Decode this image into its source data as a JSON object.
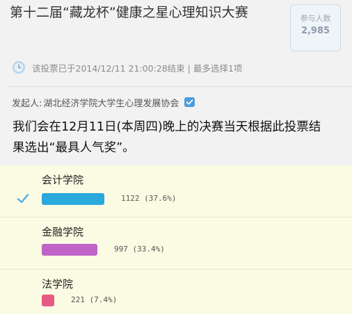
{
  "poll": {
    "title": "第十二届“藏龙杯”健康之星心理知识大赛",
    "participants_label": "参与人数",
    "participants_count": "2,985",
    "status_text": "该投票已于2014/12/11 21:00:28结束 | 最多选择1项",
    "initiator_prefix": "发起人:",
    "initiator_name": "湖北经济学院大学生心理发展协会",
    "description": "我们会在12月11日(本周四)晚上的决赛当天根据此投票结果选出“最具人气奖”。",
    "options": [
      {
        "label": "会计学院",
        "votes": "1122",
        "percent": "(37.6%)",
        "share": 0.376,
        "color": "#29a9dc",
        "selected": true
      },
      {
        "label": "金融学院",
        "votes": "997",
        "percent": "(33.4%)",
        "share": 0.334,
        "color": "#c064c8",
        "selected": false
      },
      {
        "label": "法学院",
        "votes": "221",
        "percent": "(7.4%)",
        "share": 0.074,
        "color": "#e85a86",
        "selected": false
      }
    ]
  },
  "icons": {
    "clock": "clock-icon",
    "verified": "verified-icon",
    "check": "check-icon"
  },
  "colors": {
    "options_background": "#fbfbe3",
    "check": "#5eb3e6",
    "verified": "#4a9de0"
  }
}
